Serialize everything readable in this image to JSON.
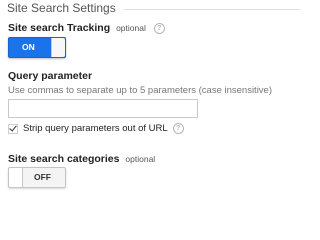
{
  "section": {
    "title": "Site Search Settings"
  },
  "tracking": {
    "label": "Site search Tracking",
    "optional": "optional",
    "help_icon": "?",
    "toggle_state": "ON"
  },
  "query": {
    "label": "Query parameter",
    "hint": "Use commas to separate up to 5 parameters (case insensitive)",
    "value": "",
    "placeholder": "",
    "strip_checkbox": {
      "checked": true,
      "label": "Strip query parameters out of URL",
      "help_icon": "?"
    }
  },
  "categories": {
    "label": "Site search categories",
    "optional": "optional",
    "toggle_state": "OFF"
  },
  "colors": {
    "accent": "#1a73e8",
    "help_icon": "#b5b5b5"
  }
}
